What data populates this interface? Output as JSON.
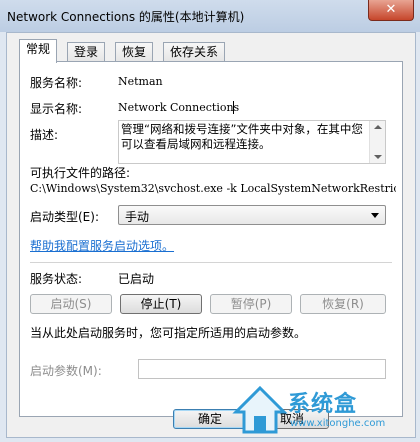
{
  "window": {
    "title": "Network Connections 的属性(本地计算机)",
    "close_glyph": "✕"
  },
  "tabs": [
    {
      "label": "常规",
      "active": true
    },
    {
      "label": "登录",
      "active": false
    },
    {
      "label": "恢复",
      "active": false
    },
    {
      "label": "依存关系",
      "active": false
    }
  ],
  "general": {
    "service_name_label": "服务名称:",
    "service_name_value": "Netman",
    "display_name_label": "显示名称:",
    "display_name_value": "Network Connections",
    "description_label": "描述:",
    "description_value": "管理“网络和拨号连接”文件夹中对象，在其中您可以查看局域网和远程连接。",
    "exe_path_label": "可执行文件的路径:",
    "exe_path_value": "C:\\Windows\\System32\\svchost.exe -k LocalSystemNetworkRestric",
    "startup_type_label": "启动类型(E):",
    "startup_type_value": "手动",
    "help_link": "帮助我配置服务启动选项。",
    "status_label": "服务状态:",
    "status_value": "已启动",
    "buttons": {
      "start": "启动(S)",
      "stop": "停止(T)",
      "pause": "暂停(P)",
      "resume": "恢复(R)"
    },
    "hint": "当从此处启动服务时，您可指定所适用的启动参数。",
    "start_params_label": "启动参数(M):",
    "start_params_value": ""
  },
  "footer": {
    "ok": "确定",
    "cancel": "取消"
  },
  "watermark": {
    "text": "系统盒",
    "url": "www.xitonghe.com"
  }
}
